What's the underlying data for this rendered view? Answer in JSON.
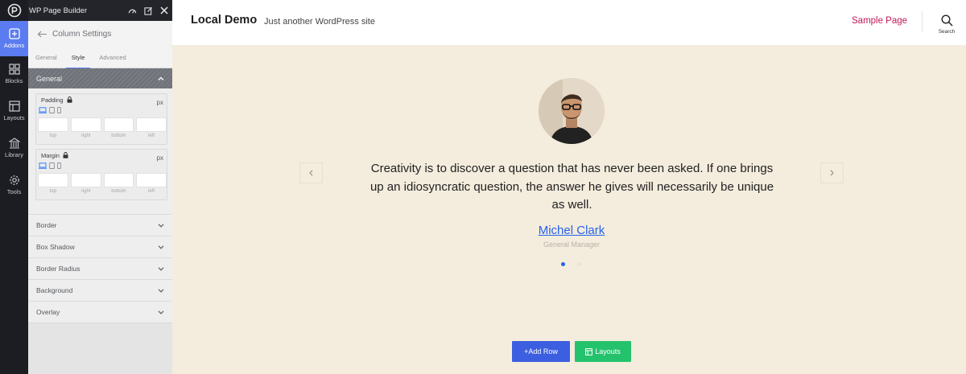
{
  "app": {
    "title": "WP Page Builder"
  },
  "rail": {
    "items": [
      {
        "label": "Addons",
        "icon": "addons-icon",
        "active": true
      },
      {
        "label": "Blocks",
        "icon": "blocks-icon",
        "active": false
      },
      {
        "label": "Layouts",
        "icon": "layouts-icon",
        "active": false
      },
      {
        "label": "Library",
        "icon": "library-icon",
        "active": false
      },
      {
        "label": "Tools",
        "icon": "tools-icon",
        "active": false
      }
    ]
  },
  "panel": {
    "title": "Column Settings",
    "tabs": [
      "General",
      "Style",
      "Advanced"
    ],
    "active_tab": "Style",
    "section": "General",
    "padding": {
      "label": "Padding",
      "unit": "px",
      "fields": [
        "top",
        "right",
        "bottom",
        "left"
      ]
    },
    "margin": {
      "label": "Margin",
      "unit": "px",
      "fields": [
        "top",
        "right",
        "bottom",
        "left"
      ]
    },
    "accordions": [
      "Border",
      "Box Shadow",
      "Border Radius",
      "Background",
      "Overlay"
    ]
  },
  "site": {
    "name": "Local Demo",
    "tagline": "Just another WordPress site",
    "nav_link": "Sample Page",
    "search_label": "Search",
    "testimonial": {
      "quote": "Creativity is to discover a question that has never been asked. If one brings up an idiosyncratic question, the answer he gives will necessarily be unique as well.",
      "author": "Michel Clark",
      "role": "General Manager",
      "slide": 1,
      "slide_count": 2
    },
    "buttons": {
      "add_row": "+Add Row",
      "layouts": "Layouts"
    }
  },
  "colors": {
    "accent": "#5b7cf0",
    "site_bg": "#f4ecdd",
    "nav_link": "#c2185b",
    "author_link": "#2563eb",
    "add_row": "#3b5fe0",
    "layouts": "#25c26e"
  }
}
